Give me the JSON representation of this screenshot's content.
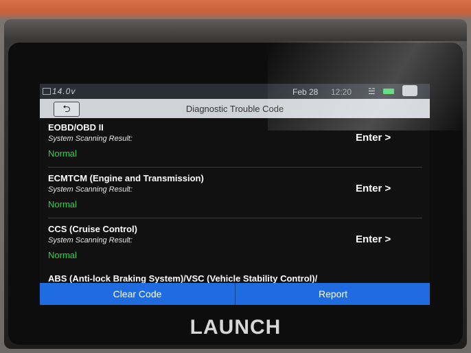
{
  "status": {
    "voltage": "14.0v",
    "date": "Feb 28",
    "time": "12:20"
  },
  "header": {
    "back_symbol": "⮌",
    "title": "Diagnostic Trouble Code"
  },
  "items": [
    {
      "name": "EOBD/OBD II",
      "sub": "System Scanning Result:",
      "result": "Normal",
      "action": "Enter >"
    },
    {
      "name": "ECMTCM (Engine and Transmission)",
      "sub": "System Scanning Result:",
      "result": "Normal",
      "action": "Enter >"
    },
    {
      "name": "CCS (Cruise Control)",
      "sub": "System Scanning Result:",
      "result": "Normal",
      "action": "Enter >"
    }
  ],
  "partial_item": "ABS (Anti-lock Braking System)/VSC (Vehicle Stability Control)/",
  "footer": {
    "clear_label": "Clear Code",
    "report_label": "Report"
  },
  "brand": "LAUNCH",
  "colors": {
    "accent": "#1f6be0",
    "status_ok": "#2ed34a"
  }
}
